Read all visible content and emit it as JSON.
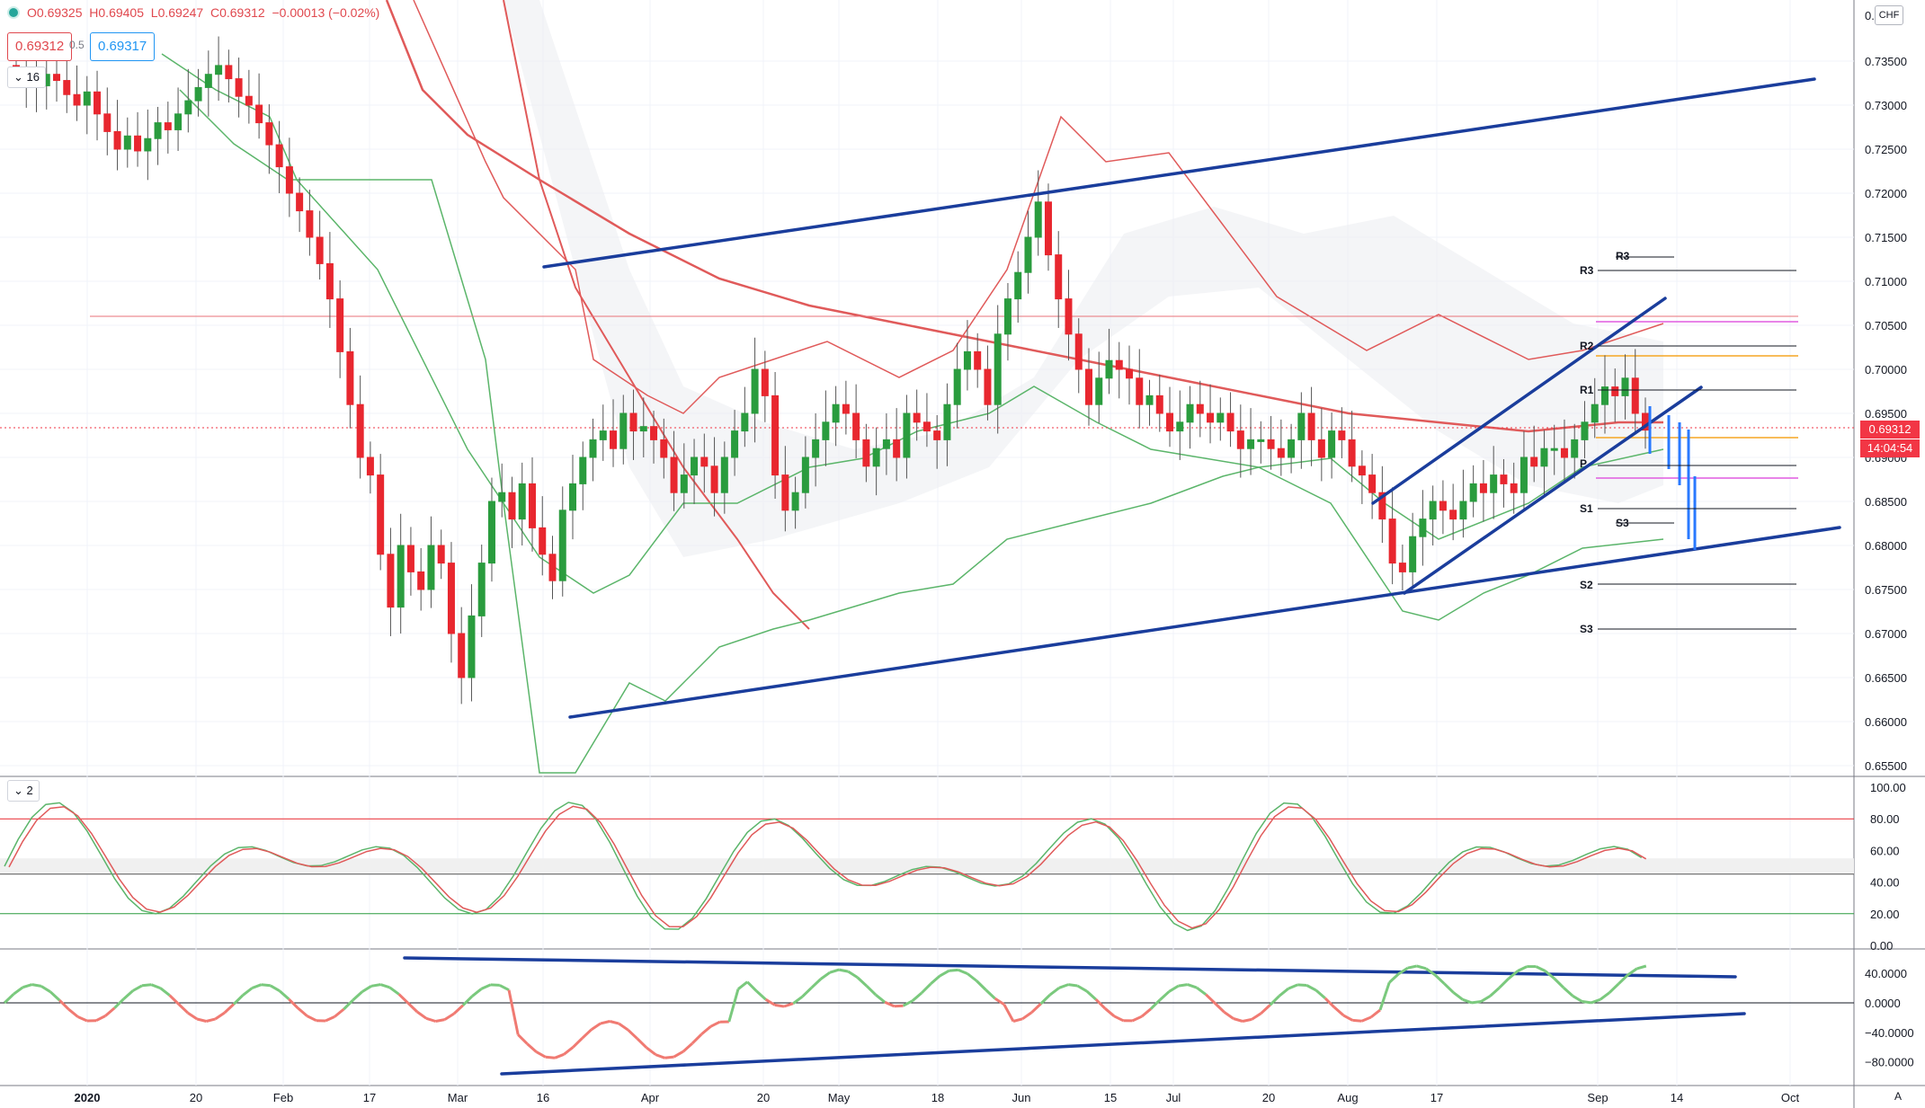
{
  "header": {
    "ohlc_o": "O0.69325",
    "ohlc_h": "H0.69405",
    "ohlc_l": "L0.69247",
    "ohlc_c": "C0.69312",
    "ohlc_change": "−0.00013 (−0.02%)",
    "sell_price": "0.69312",
    "spread": "0.5",
    "buy_price": "0.69317",
    "currency": "CHF"
  },
  "indicators": {
    "main_period": "16",
    "stoch_count": "2"
  },
  "price_axis": {
    "ticks": [
      "0.73500",
      "0.73000",
      "0.72500",
      "0.72000",
      "0.71500",
      "0.71000",
      "0.70500",
      "0.70000",
      "0.69500",
      "0.69000",
      "0.68500",
      "0.68000",
      "0.67500",
      "0.67000",
      "0.66500",
      "0.66000",
      "0.65500"
    ],
    "top_cut": "0.",
    "last_price": "0.69312",
    "countdown": "14:04:54",
    "partial_under": "0.69000"
  },
  "stoch_axis": {
    "ticks": [
      "100.00",
      "80.00",
      "60.00",
      "40.00",
      "20.00",
      "0.00"
    ]
  },
  "cci_axis": {
    "ticks": [
      "40.0000",
      "0.0000",
      "−40.0000",
      "−80.0000"
    ]
  },
  "time_axis": {
    "labels": [
      "2020",
      "20",
      "Feb",
      "17",
      "Mar",
      "16",
      "Apr",
      "20",
      "May",
      "18",
      "Jun",
      "15",
      "Jul",
      "20",
      "Aug",
      "17",
      "Sep",
      "14",
      "Oct"
    ],
    "auto_label": "A"
  },
  "pivots": {
    "labels": [
      "R3",
      "R3",
      "R2",
      "R1",
      "P",
      "S1",
      "S3",
      "S2",
      "S3"
    ]
  },
  "colors": {
    "bull": "#2a9c3e",
    "bear": "#e8272f",
    "trend": "#1a3d9c",
    "bollinger": "#e05a5a",
    "lower_band": "#5bb56a"
  }
}
